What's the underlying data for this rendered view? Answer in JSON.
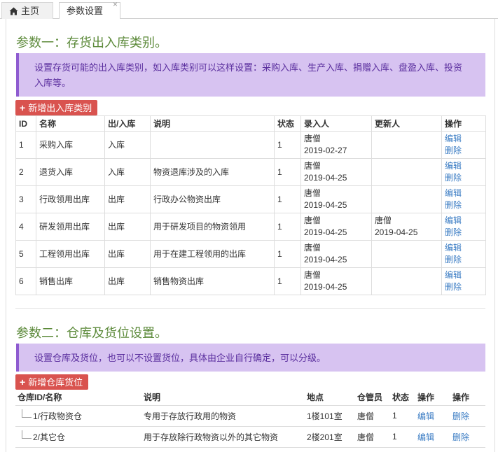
{
  "tabs": [
    {
      "label": "主页",
      "icon": "home-icon"
    },
    {
      "label": "参数设置",
      "close": "×"
    }
  ],
  "section1": {
    "title": "参数一：存货出入库类别。",
    "notice": "设置存货可能的出入库类别，如入库类别可以这样设置：采购入库、生产入库、捐赠入库、盘盈入库、投资入库等。",
    "add_label": "新增出入库类别",
    "columns": [
      "ID",
      "名称",
      "出/入库",
      "说明",
      "状态",
      "录入人",
      "更新人",
      "操作"
    ],
    "rows": [
      {
        "id": "1",
        "name": "采购入库",
        "dir": "入库",
        "desc": "",
        "status": "1",
        "creator": "唐僧",
        "created": "2019-02-27",
        "updater": "",
        "updated": "",
        "edit": "编辑",
        "del": "删除"
      },
      {
        "id": "2",
        "name": "退货入库",
        "dir": "入库",
        "desc": "物资退库涉及的入库",
        "status": "1",
        "creator": "唐僧",
        "created": "2019-04-25",
        "updater": "",
        "updated": "",
        "edit": "编辑",
        "del": "删除"
      },
      {
        "id": "3",
        "name": "行政领用出库",
        "dir": "出库",
        "desc": "行政办公物资出库",
        "status": "1",
        "creator": "唐僧",
        "created": "2019-04-25",
        "updater": "",
        "updated": "",
        "edit": "编辑",
        "del": "删除"
      },
      {
        "id": "4",
        "name": "研发领用出库",
        "dir": "出库",
        "desc": "用于研发项目的物资领用",
        "status": "1",
        "creator": "唐僧",
        "created": "2019-04-25",
        "updater": "唐僧",
        "updated": "2019-04-25",
        "edit": "编辑",
        "del": "删除"
      },
      {
        "id": "5",
        "name": "工程领用出库",
        "dir": "出库",
        "desc": "用于在建工程领用的出库",
        "status": "1",
        "creator": "唐僧",
        "created": "2019-04-25",
        "updater": "",
        "updated": "",
        "edit": "编辑",
        "del": "删除"
      },
      {
        "id": "6",
        "name": "销售出库",
        "dir": "出库",
        "desc": "销售物资出库",
        "status": "1",
        "creator": "唐僧",
        "created": "2019-04-25",
        "updater": "",
        "updated": "",
        "edit": "编辑",
        "del": "删除"
      }
    ]
  },
  "section2": {
    "title": "参数二：仓库及货位设置。",
    "notice": "设置仓库及货位，也可以不设置货位，具体由企业自行确定，可以分级。",
    "add_label": "新增仓库货位",
    "columns": [
      "仓库ID/名称",
      "说明",
      "地点",
      "仓管员",
      "状态",
      "操作",
      "操作"
    ],
    "rows": [
      {
        "name": "1/行政物资仓",
        "desc": "专用于存放行政用的物资",
        "location": "1楼101室",
        "keeper": "唐僧",
        "status": "1",
        "edit": "编辑",
        "del": "删除"
      },
      {
        "name": "2/其它仓",
        "desc": "用于存放除行政物资以外的其它物资",
        "location": "2楼201室",
        "keeper": "唐僧",
        "status": "1",
        "edit": "编辑",
        "del": "删除"
      }
    ]
  }
}
